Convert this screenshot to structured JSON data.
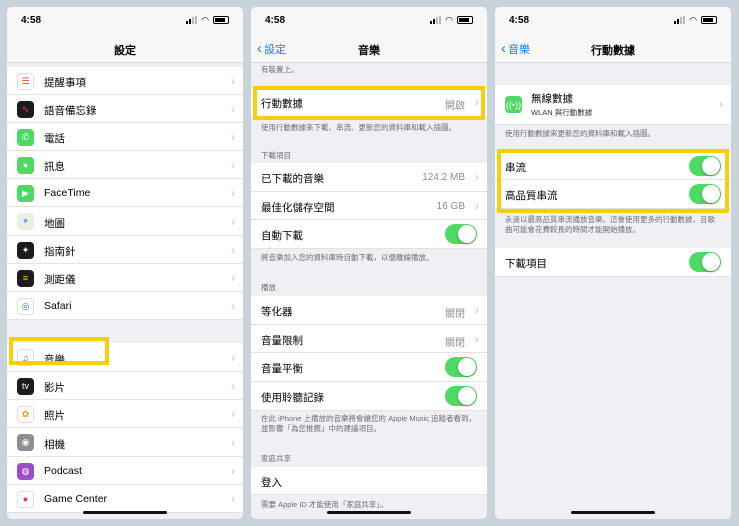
{
  "status": {
    "time": "4:58"
  },
  "screen1": {
    "title": "設定",
    "items": [
      {
        "label": "提醒事項",
        "color": "#ffffff",
        "glyph": "☰",
        "fg": "#ff3b30"
      },
      {
        "label": "語音備忘錄",
        "color": "#1c1c1e",
        "glyph": "∿",
        "fg": "#ff3b30"
      },
      {
        "label": "電話",
        "color": "#4cd964",
        "glyph": "✆",
        "fg": "#ffffff"
      },
      {
        "label": "訊息",
        "color": "#4cd964",
        "glyph": "●",
        "fg": "#ffffff"
      },
      {
        "label": "FaceTime",
        "color": "#4cd964",
        "glyph": "▶",
        "fg": "#ffffff"
      },
      {
        "label": "地圖",
        "color": "#e8f0e0",
        "glyph": "⌖",
        "fg": "#147efb"
      },
      {
        "label": "指南針",
        "color": "#1c1c1e",
        "glyph": "✦",
        "fg": "#ffffff"
      },
      {
        "label": "測距儀",
        "color": "#1c1c1e",
        "glyph": "≡",
        "fg": "#ffcc00"
      },
      {
        "label": "Safari",
        "color": "#ffffff",
        "glyph": "◎",
        "fg": "#147efb"
      },
      {
        "label": "音樂",
        "color": "#ffffff",
        "glyph": "♫",
        "fg": "#ff2d55"
      },
      {
        "label": "影片",
        "color": "#1c1c1e",
        "glyph": "tv",
        "fg": "#ffffff"
      },
      {
        "label": "照片",
        "color": "#ffffff",
        "glyph": "✿",
        "fg": "#ff9500"
      },
      {
        "label": "相機",
        "color": "#8e8e93",
        "glyph": "◉",
        "fg": "#ffffff"
      },
      {
        "label": "Podcast",
        "color": "#9b4dca",
        "glyph": "◍",
        "fg": "#ffffff"
      },
      {
        "label": "Game Center",
        "color": "#ffffff",
        "glyph": "●",
        "fg": "#ff2d55"
      }
    ]
  },
  "screen2": {
    "back": "設定",
    "title": "音樂",
    "top_partial": "有裝置上。",
    "cellular": {
      "label": "行動數據",
      "value": "開啟"
    },
    "cellular_footer": "使用行動數據來下載、串流、更新您的資料庫和載入插圖。",
    "downloads_header": "下載項目",
    "downloaded_music": {
      "label": "已下載的音樂",
      "value": "124.2 MB"
    },
    "optimize": {
      "label": "最佳化儲存空間",
      "value": "16 GB"
    },
    "auto_download": {
      "label": "自動下載"
    },
    "auto_footer": "將音樂加入您的資料庫時自動下載，以便離線播放。",
    "playback_header": "播放",
    "eq": {
      "label": "等化器",
      "value": "關閉"
    },
    "volume_limit": {
      "label": "音量限制",
      "value": "關閉"
    },
    "sound_check": {
      "label": "音量平衡"
    },
    "history": {
      "label": "使用聆聽記錄"
    },
    "history_footer": "在此 iPhone 上播放的音樂將會讓您的 Apple Music 追蹤者看到，並影響「為您推薦」中的建議項目。",
    "family_header": "家庭共享",
    "signin": "登入",
    "signin_footer": "需要 Apple ID 才能使用「家庭共享」。"
  },
  "screen3": {
    "back": "音樂",
    "title": "行動數據",
    "cellular": {
      "label": "無線數據",
      "sub": "WLAN 與行動數據"
    },
    "cellular_footer": "使用行動數據來更新您的資料庫和載入插圖。",
    "streaming": {
      "label": "串流"
    },
    "hq_streaming": {
      "label": "高品質串流"
    },
    "streaming_footer": "永遠以最高品質串流播放音樂。這會使用更多的行動數據，且歌曲可能會花費較長的時間才能開始播放。",
    "downloads": {
      "label": "下載項目"
    }
  }
}
